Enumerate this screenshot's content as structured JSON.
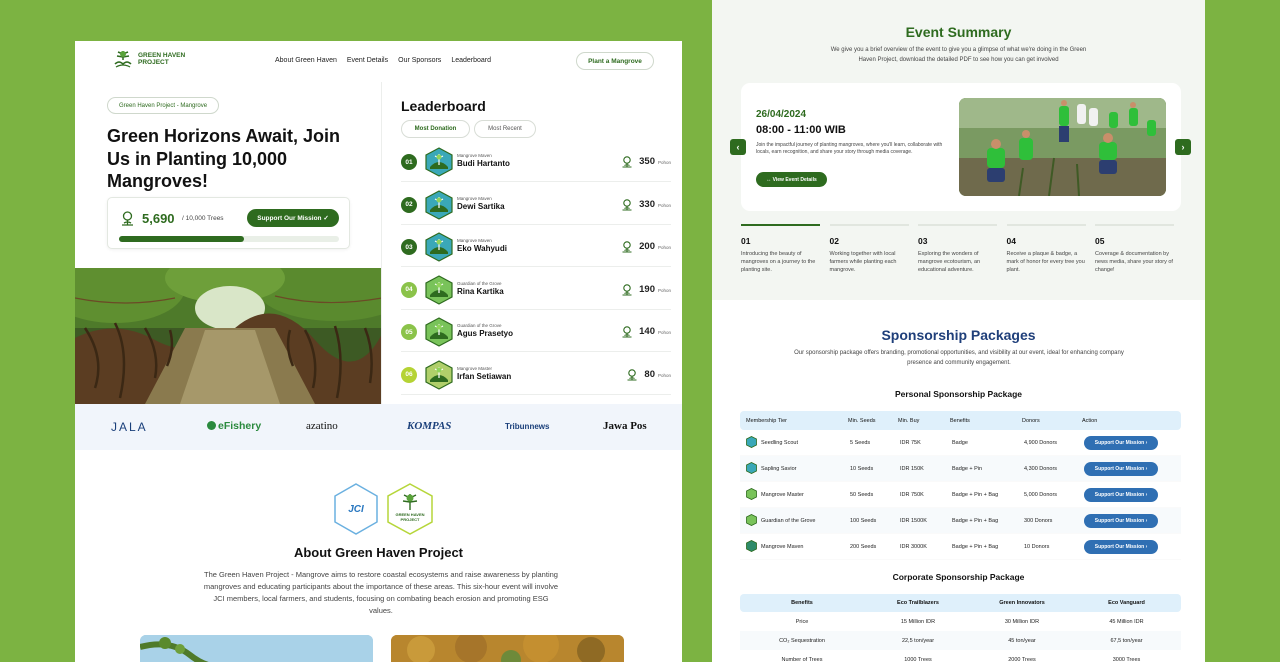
{
  "brand": {
    "name_line1": "GREEN HAVEN",
    "name_line2": "PROJECT"
  },
  "nav": {
    "links": [
      "About Green Haven",
      "Event Details",
      "Our Sponsors",
      "Leaderboard"
    ],
    "cta": "Plant a Mangrove"
  },
  "hero": {
    "pill": "Green Haven Project - Mangrove",
    "title": "Green Horizons Await, Join Us in Planting 10,000 Mangroves!",
    "stat_value": "5,690",
    "stat_target": "/ 10,000 Trees",
    "progress": 0.569,
    "button": "Support Our Mission ✓"
  },
  "leaderboard": {
    "title": "Leaderboard",
    "tabs": [
      "Most Donation",
      "Most Recent"
    ],
    "unit": "Pohon",
    "rows": [
      {
        "rank": "01",
        "tier": "Mangrove Maven",
        "name": "Budi Hartanto",
        "points": "350"
      },
      {
        "rank": "02",
        "tier": "Mangrove Maven",
        "name": "Dewi Sartika",
        "points": "330"
      },
      {
        "rank": "03",
        "tier": "Mangrove Maven",
        "name": "Eko Wahyudi",
        "points": "200"
      },
      {
        "rank": "04",
        "tier": "Guardian of the Grove",
        "name": "Rina Kartika",
        "points": "190"
      },
      {
        "rank": "05",
        "tier": "Guardian of the Grove",
        "name": "Agus Prasetyo",
        "points": "140"
      },
      {
        "rank": "06",
        "tier": "Mangrove Master",
        "name": "Irfan Setiawan",
        "points": "80"
      }
    ]
  },
  "sponsors": [
    "JALA",
    "eFishery",
    "azatino",
    "KOMPAS",
    "Tribunnews",
    "Jawa Pos"
  ],
  "about": {
    "logo_jci": "JCI",
    "logo_gh_line1": "GREEN HAVEN",
    "logo_gh_line2": "PROJECT",
    "title": "About Green Haven Project",
    "text": "The Green Haven Project - Mangrove aims to restore coastal ecosystems and raise awareness by planting mangroves and educating participants about the importance of these areas. This six-hour event will involve JCI members, local farmers, and students, focusing on combating beach erosion and promoting ESG values."
  },
  "event": {
    "title": "Event Summary",
    "subtitle": "We give you a brief overview of the event to give you a glimpse of what we're doing in the Green Haven Project, download the detailed PDF to see how you can get involved",
    "date": "26/04/2024",
    "time": "08:00 - 11:00 WIB",
    "desc": "Join the impactful journey of planting mangroves, where you'll learn, collaborate with locals, earn recognition, and share your story through media coverage.",
    "button": "↔ View Event Details",
    "steps": [
      {
        "num": "01",
        "text": "Introducing the beauty of mangroves on a journey to the planting site."
      },
      {
        "num": "02",
        "text": "Working together with local farmers while planting each mangrove."
      },
      {
        "num": "03",
        "text": "Exploring the wonders of mangrove ecotourism, an educational adventure."
      },
      {
        "num": "04",
        "text": "Receive a plaque & badge, a mark of honor for every tree you plant."
      },
      {
        "num": "05",
        "text": "Coverage & documentation by news media, share your story of change!"
      }
    ]
  },
  "sponsorship": {
    "title": "Sponsorship Packages",
    "subtitle": "Our sponsorship package offers branding, promotional opportunities, and visibility at our event, ideal for enhancing company presence and community engagement.",
    "personal_title": "Personal Sponsorship Package",
    "personal_headers": [
      "Membership Tier",
      "Min. Seeds",
      "Min. Buy",
      "Benefits",
      "Donors",
      "Action"
    ],
    "personal_rows": [
      {
        "tier": "Seedling Scout",
        "seeds": "5 Seeds",
        "buy": "IDR 75K",
        "benefits": "Badge",
        "donors": "4,900 Donors",
        "action": "Support Our Mission ›"
      },
      {
        "tier": "Sapling Savior",
        "seeds": "10 Seeds",
        "buy": "IDR 150K",
        "benefits": "Badge + Pin",
        "donors": "4,300 Donors",
        "action": "Support Our Mission ›"
      },
      {
        "tier": "Mangrove Master",
        "seeds": "50 Seeds",
        "buy": "IDR 750K",
        "benefits": "Badge + Pin + Bag",
        "donors": "5,000 Donors",
        "action": "Support Our Mission ›"
      },
      {
        "tier": "Guardian of the Grove",
        "seeds": "100 Seeds",
        "buy": "IDR 1500K",
        "benefits": "Badge + Pin + Bag",
        "donors": "300 Donors",
        "action": "Support Our Mission ›"
      },
      {
        "tier": "Mangrove Maven",
        "seeds": "200 Seeds",
        "buy": "IDR 3000K",
        "benefits": "Badge + Pin + Bag",
        "donors": "10 Donors",
        "action": "Support Our Mission ›"
      }
    ],
    "corporate_title": "Corporate Sponsorship Package",
    "corporate_headers": [
      "Benefits",
      "Eco Trailblazers",
      "Green Innovators",
      "Eco Vanguard"
    ],
    "corporate_rows": [
      [
        "Price",
        "15 Million IDR",
        "30 Million IDR",
        "45 Million IDR"
      ],
      [
        "CO₂ Sequestration",
        "22,5 ton/year",
        "45 ton/year",
        "67,5 ton/year"
      ],
      [
        "Number of Trees",
        "1000 Trees",
        "2000 Trees",
        "3000 Trees"
      ]
    ]
  },
  "colors": {
    "green": "#2e6b1f",
    "blue": "#2f6fb3",
    "navy": "#1f3f7a",
    "bg": "#7cb342"
  }
}
